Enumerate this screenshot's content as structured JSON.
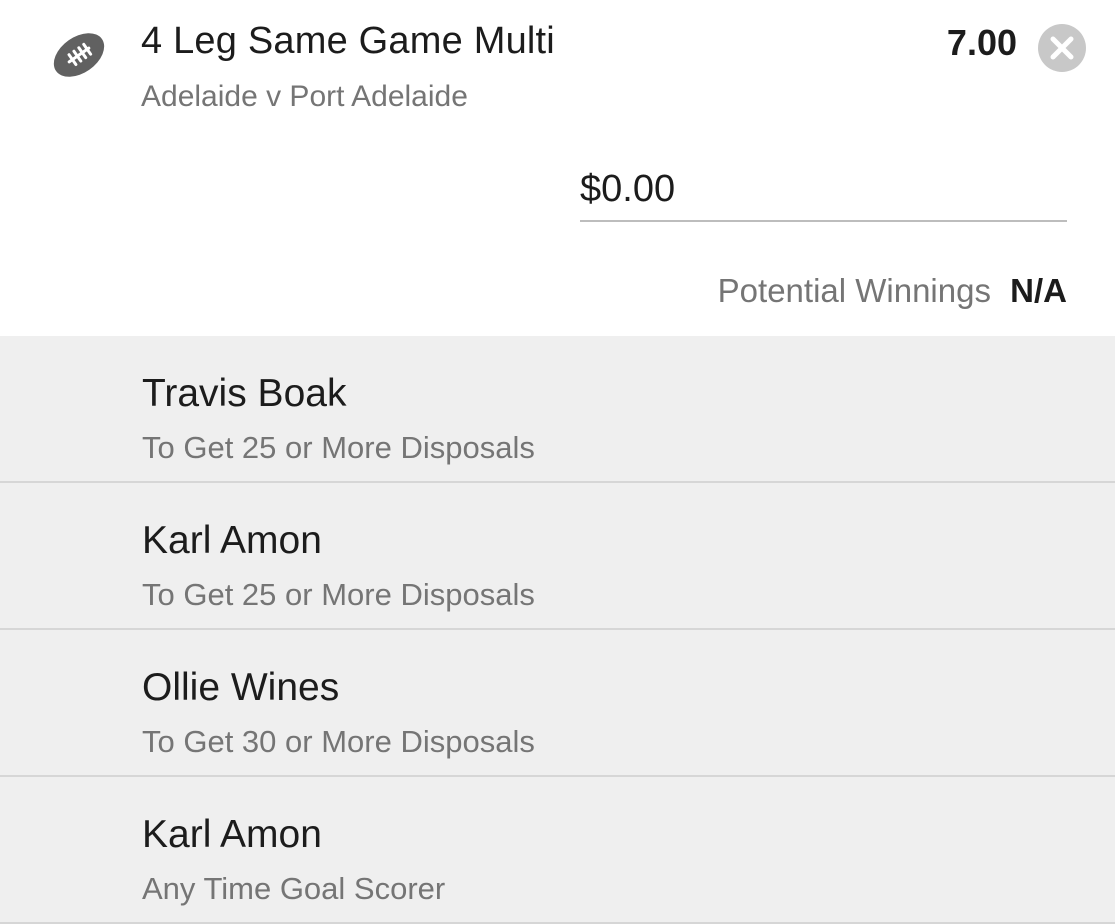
{
  "bet": {
    "sport_icon": "football-icon",
    "title": "4 Leg Same Game Multi",
    "match": "Adelaide v Port Adelaide",
    "odds": "7.00",
    "remove_icon": "close-icon"
  },
  "stake": {
    "value": "$0.00"
  },
  "winnings": {
    "label": "Potential Winnings",
    "value": "N/A"
  },
  "legs": [
    {
      "name": "Travis Boak",
      "market": "To Get 25 or More Disposals"
    },
    {
      "name": "Karl Amon",
      "market": "To Get 25 or More Disposals"
    },
    {
      "name": "Ollie Wines",
      "market": "To Get 30 or More Disposals"
    },
    {
      "name": "Karl Amon",
      "market": "Any Time Goal Scorer"
    }
  ],
  "colors": {
    "background": "#ffffff",
    "legs_background": "#efefef",
    "secondary_text": "#757575",
    "icon": "#616161",
    "remove_button": "#c8c8c8"
  }
}
